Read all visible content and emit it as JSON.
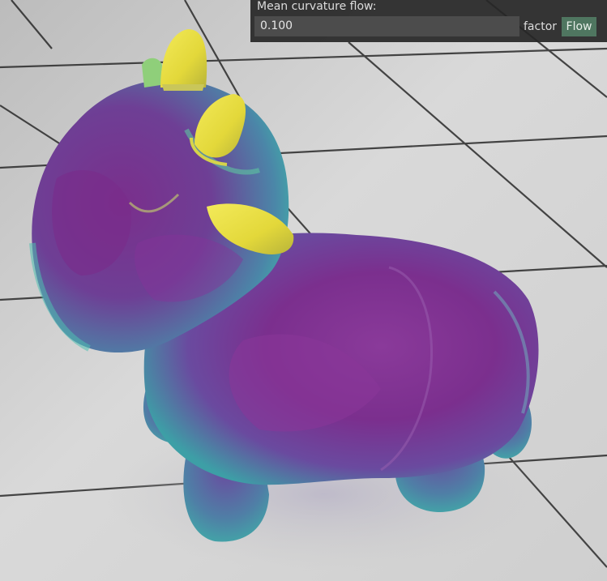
{
  "panel": {
    "title": "Mean curvature flow:",
    "factor_value": "0.100",
    "factor_label": "factor",
    "flow_button": "Flow"
  },
  "colors": {
    "floor_light": "#d6d6d6",
    "floor_dark": "#a9a9a9",
    "grout": "#2a2a2a",
    "mesh_purple": "#7a2d8c",
    "mesh_teal": "#3fa7a8",
    "mesh_yellow": "#e9df3e",
    "panel_bg": "#262626",
    "input_bg": "#4c4c4c",
    "button_bg": "#4f7660"
  },
  "viewport": {
    "content": "3D rendered cow mesh colored by mean curvature on a tiled floor"
  }
}
